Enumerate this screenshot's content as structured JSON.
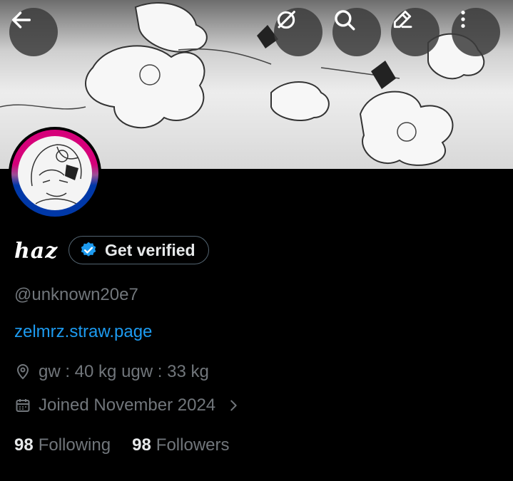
{
  "header": {
    "back_icon": "arrow-left-icon",
    "grok_icon": "slashed-circle-icon",
    "search_icon": "search-icon",
    "edit_icon": "pencil-icon",
    "more_icon": "more-vertical-icon"
  },
  "profile": {
    "display_name": "haz",
    "verify_button_label": "Get verified",
    "handle": "@unknown20e7",
    "website": "zelmrz.straw.page",
    "location": "gw : 40 kg ugw : 33 kg",
    "joined": "Joined November 2024"
  },
  "stats": {
    "following_count": "98",
    "following_label": "Following",
    "followers_count": "98",
    "followers_label": "Followers"
  },
  "colors": {
    "background": "#000000",
    "link": "#1d9bf0",
    "muted": "#71767b",
    "verified_badge": "#1d9bf0"
  }
}
